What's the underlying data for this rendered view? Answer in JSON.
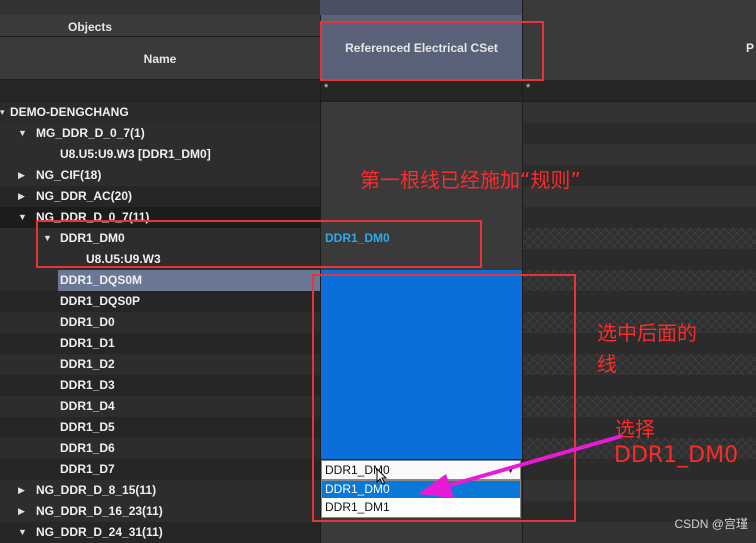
{
  "header": {
    "objects_label": "Objects",
    "name_label": "Name",
    "cset_label": "Referenced Electrical CSet",
    "next_col_label": "P",
    "filter_name": "",
    "filter_cset": "*",
    "filter_next": "*"
  },
  "rows": [
    {
      "label": "DEMO-DENGCHANG",
      "expander": "▾",
      "cset": ""
    },
    {
      "label": "MG_DDR_D_0_7(1)",
      "expander": "▼",
      "cset": ""
    },
    {
      "label": "U8.U5:U9.W3 [DDR1_DM0]",
      "expander": "",
      "cset": ""
    },
    {
      "label": "NG_CIF(18)",
      "expander": "▶",
      "cset": ""
    },
    {
      "label": "NG_DDR_AC(20)",
      "expander": "▶",
      "cset": ""
    },
    {
      "label": "NG_DDR_D_0_7(11)",
      "expander": "▼",
      "cset": ""
    },
    {
      "label": "DDR1_DM0",
      "expander": "▼",
      "cset": "DDR1_DM0"
    },
    {
      "label": "U8.U5:U9.W3",
      "expander": "",
      "cset": ""
    },
    {
      "label": "DDR1_DQS0M",
      "expander": "",
      "cset": ""
    },
    {
      "label": "DDR1_DQS0P",
      "expander": "",
      "cset": ""
    },
    {
      "label": "DDR1_D0",
      "expander": "",
      "cset": ""
    },
    {
      "label": "DDR1_D1",
      "expander": "",
      "cset": ""
    },
    {
      "label": "DDR1_D2",
      "expander": "",
      "cset": ""
    },
    {
      "label": "DDR1_D3",
      "expander": "",
      "cset": ""
    },
    {
      "label": "DDR1_D4",
      "expander": "",
      "cset": ""
    },
    {
      "label": "DDR1_D5",
      "expander": "",
      "cset": ""
    },
    {
      "label": "DDR1_D6",
      "expander": "",
      "cset": ""
    },
    {
      "label": "DDR1_D7",
      "expander": "",
      "cset": ""
    },
    {
      "label": "NG_DDR_D_8_15(11)",
      "expander": "▶",
      "cset": ""
    },
    {
      "label": "NG_DDR_D_16_23(11)",
      "expander": "▶",
      "cset": ""
    },
    {
      "label": "NG_DDR_D_24_31(11)",
      "expander": "▼",
      "cset": ""
    }
  ],
  "dropdown": {
    "current_value": "DDR1_DM0",
    "options": [
      "DDR1_DM0",
      "DDR1_DM1"
    ],
    "selected_index": 0
  },
  "annotations": {
    "first_net": "第一根线已经施加“规则”",
    "select_nets_line1": "选中后面的",
    "select_nets_line2": "线",
    "choose_line1": "选择",
    "choose_line2": "DDR1_DM0"
  },
  "watermark": "CSDN @宫瑾",
  "colors": {
    "selection_blue": "#0a6fd8",
    "selected_row": "#6a7896",
    "annotation_red": "#ff2a2a",
    "arrow_magenta": "#e81ad6",
    "cset_text": "#2fa9e8"
  }
}
